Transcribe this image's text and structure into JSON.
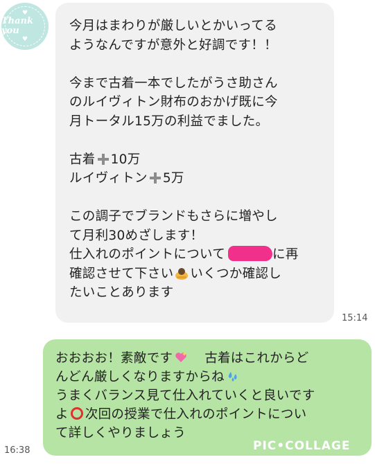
{
  "incoming": {
    "avatar_text": "Thank you",
    "lines": [
      "今月はまわりが厳しいとかいってる",
      "ようなんですが意外と好調です！！",
      "",
      "今まで古着一本でしたがうさ助さん",
      "のルイヴィトン財布のおかげ既に今",
      "月トータル15万の利益でました。",
      ""
    ],
    "item1_label": "古着",
    "item1_value": "10万",
    "item2_label": "ルイヴィトン",
    "item2_value": "5万",
    "lines2": [
      "この調子でブランドもさらに増やし",
      "て月利30めざします！"
    ],
    "line_redact_before": "仕入れのポイントについて",
    "line_redact_after": "に再",
    "line_emoji_before": "確認させて下さい",
    "line_emoji_after": "いくつか確認し",
    "last_line": "たいことあります",
    "time": "15:14"
  },
  "outgoing": {
    "line1_a": "おおおお！素敵です",
    "line1_b": "古着はこれからど",
    "line2": "んどん厳しくなりますからね",
    "line3": "うまくバランス見て仕入れていくと良いです",
    "line4_a": "よ",
    "line4_b": "次回の授業で仕入れのポイントについ",
    "line5": "て詳しくやりましょう",
    "time": "16:38"
  },
  "watermark": "PIC•COLLAGE",
  "colors": {
    "incoming_bubble": "#f1f1f1",
    "outgoing_bubble": "#b6e4a4",
    "avatar": "#bfe6e1",
    "redaction": "#f0308a"
  }
}
